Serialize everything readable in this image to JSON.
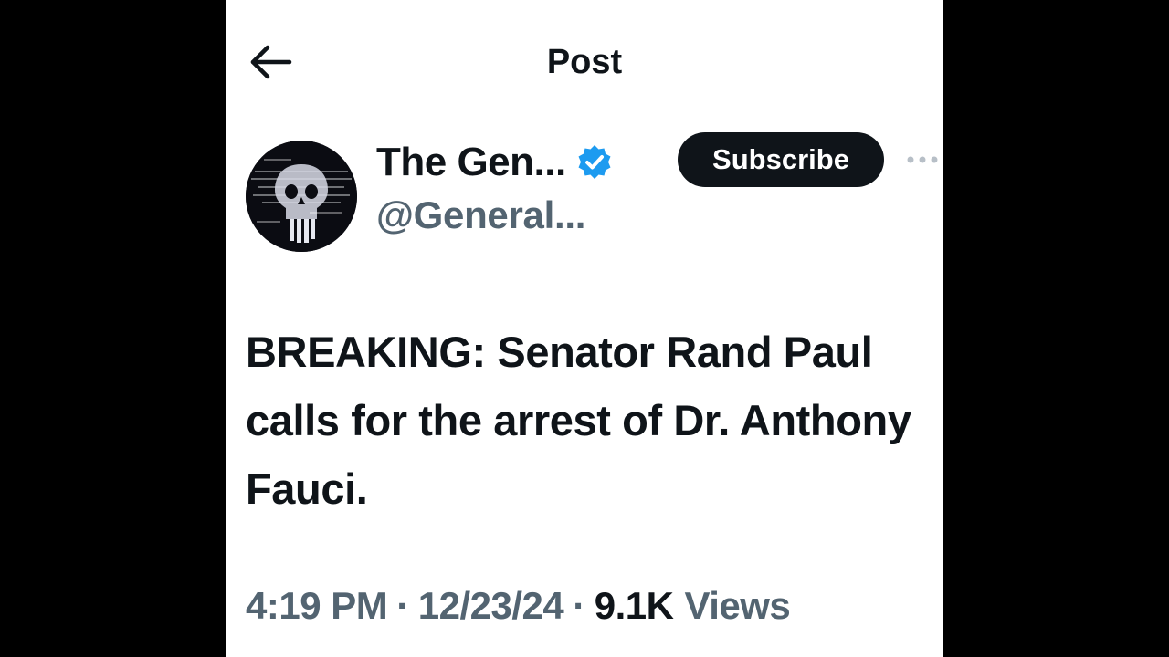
{
  "header": {
    "title": "Post",
    "back_icon": "arrow-left-icon"
  },
  "author": {
    "display_name": "The Gen...",
    "handle": "@General...",
    "verified": true,
    "verified_color": "#1d9bf0",
    "avatar_icon": "skull-avatar"
  },
  "actions": {
    "subscribe_label": "Subscribe",
    "more_icon": "more-dots-icon"
  },
  "post": {
    "text": "BREAKING: Senator Rand Paul calls for the arrest of Dr. Anthony Fauci."
  },
  "meta": {
    "time": "4:19 PM",
    "separator": "·",
    "date": "12/23/24",
    "views_count": "9.1K",
    "views_label": "Views"
  },
  "colors": {
    "primary_text": "#0f1419",
    "secondary_text": "#536471",
    "background": "#ffffff",
    "letterbox": "#000000"
  }
}
